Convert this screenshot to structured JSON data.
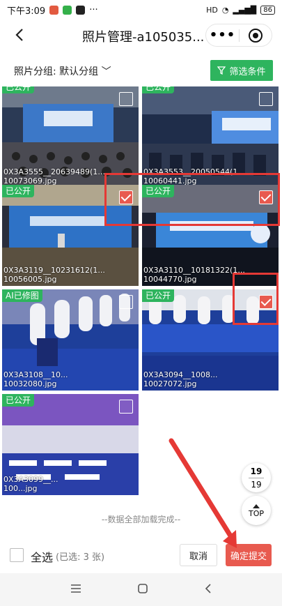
{
  "status": {
    "time": "下午3:09",
    "battery": "86",
    "net": "HD"
  },
  "header": {
    "title": "照片管理-a105035...",
    "more": "•••"
  },
  "filter": {
    "group_label": "照片分组: 默认分组",
    "button": "筛选条件"
  },
  "photos": [
    {
      "badge": "已公开",
      "name": "0X3A3555__20639489(1...\n10073069.jpg",
      "checked": false
    },
    {
      "badge": "已公开",
      "name": "0X3A3553__20050544(1...\n10060441.jpg",
      "checked": false
    },
    {
      "badge": "已公开",
      "name": "0X3A3119__10231612(1...\n10056005.jpg",
      "checked": true
    },
    {
      "badge": "已公开",
      "name": "0X3A3110__10181322(1...\n10044770.jpg",
      "checked": true
    },
    {
      "badge": "AI已修图",
      "name": "0X3A3108__10...\n10032080.jpg",
      "checked": false
    },
    {
      "badge": "已公开",
      "name": "0X3A3094__1008...\n10027072.jpg",
      "checked": true
    },
    {
      "badge": "已公开",
      "name": "0X3A3099__...\n100...jpg",
      "checked": false
    }
  ],
  "pager": {
    "current": "19",
    "total": "19"
  },
  "top_label": "TOP",
  "load_done": "--数据全部加载完成--",
  "bottom": {
    "select_all": "全选",
    "selected": "(已选: 3 张)",
    "cancel": "取消",
    "submit": "确定提交"
  },
  "colors": {
    "accent_green": "#2eb45e",
    "accent_red": "#e85a4f",
    "highlight": "#e53935"
  }
}
